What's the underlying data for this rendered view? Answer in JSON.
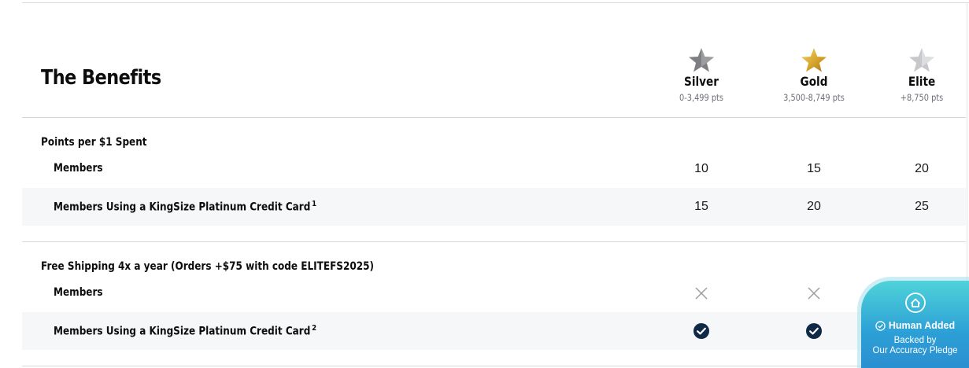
{
  "page": {
    "title": "The Benefits"
  },
  "tiers": [
    {
      "name": "Silver",
      "range": "0-3,499 pts",
      "star_color": "#7d7f83"
    },
    {
      "name": "Gold",
      "range": "3,500-8,749 pts",
      "star_color": "#d4a52a"
    },
    {
      "name": "Elite",
      "range": "+8,750 pts",
      "star_color": "#c6c8cb"
    }
  ],
  "sections": [
    {
      "title": "Points per $1 Spent",
      "rows": [
        {
          "label": "Members",
          "sup": "",
          "values": [
            "10",
            "15",
            "20"
          ]
        },
        {
          "label": "Members Using a KingSize Platinum Credit Card",
          "sup": "1",
          "values": [
            "15",
            "20",
            "25"
          ]
        }
      ]
    },
    {
      "title": "Free Shipping 4x a year (Orders +$75 with code ELITEFS2025)",
      "rows": [
        {
          "label": "Members",
          "sup": "",
          "icons": [
            "cross-icon",
            "cross-icon",
            "check-icon"
          ]
        },
        {
          "label": "Members Using a KingSize Platinum Credit Card",
          "sup": "2",
          "icons": [
            "check-icon",
            "check-icon",
            "check-icon"
          ]
        }
      ]
    }
  ],
  "colors": {
    "check": "#0e2a47",
    "cross": "#9a9a9a",
    "badge": "#2c9fd6"
  },
  "badge": {
    "headline": "Human Added",
    "line1": "Backed by",
    "line2": "Our Accuracy Pledge"
  }
}
